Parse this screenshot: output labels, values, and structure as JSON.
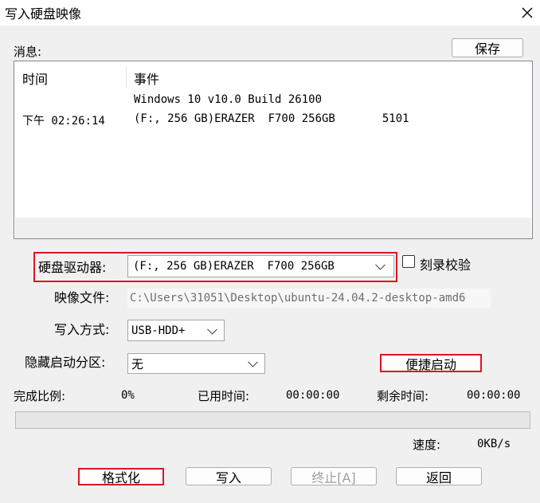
{
  "window": {
    "title": "写入硬盘映像"
  },
  "messages": {
    "label": "消息:",
    "save_button": "保存",
    "columns": [
      "时间",
      "事件"
    ],
    "rows": [
      {
        "time": "",
        "event": "Windows 10 v10.0 Build 26100"
      },
      {
        "time": "下午 02:26:14",
        "event": "(F:, 256 GB)ERAZER  F700 256GB       5101"
      }
    ]
  },
  "form": {
    "drive_label": "硬盘驱动器:",
    "drive_value": "(F:, 256 GB)ERAZER  F700 256GB",
    "verify_label": "刻录校验",
    "verify_checked": false,
    "image_label": "映像文件:",
    "image_value": "C:\\Users\\31051\\Desktop\\ubuntu-24.04.2-desktop-amd6",
    "write_mode_label": "写入方式:",
    "write_mode_value": "USB-HDD+",
    "hidden_part_label": "隐藏启动分区:",
    "hidden_part_value": "无",
    "quick_boot_button": "便捷启动"
  },
  "progress": {
    "done_label": "完成比例:",
    "done_value": "0%",
    "elapsed_label": "已用时间:",
    "elapsed_value": "00:00:00",
    "remaining_label": "剩余时间:",
    "remaining_value": "00:00:00",
    "fraction": 0,
    "speed_label": "速度:",
    "speed_value": "0KB/s"
  },
  "buttons": {
    "format": "格式化",
    "write": "写入",
    "stop": "终止[A]",
    "back": "返回"
  },
  "colors": {
    "highlight_border": "#e0141e",
    "background": "#f0f0f0"
  }
}
